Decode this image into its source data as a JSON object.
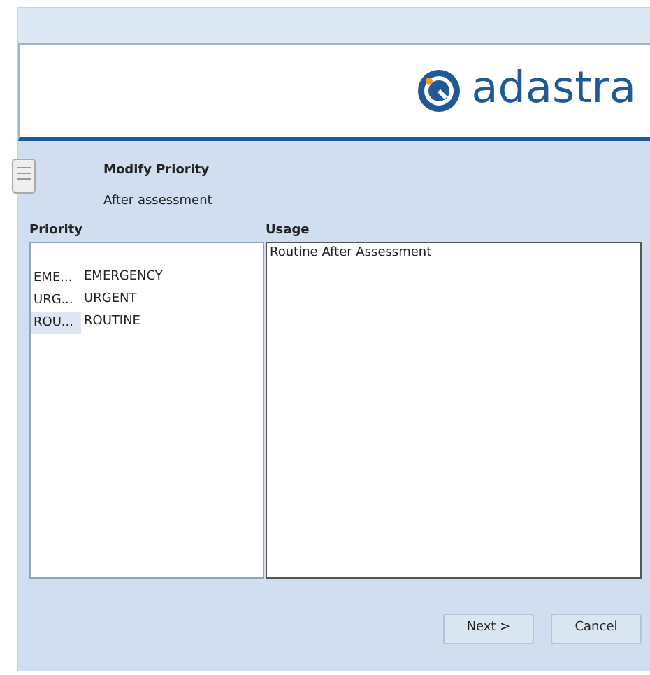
{
  "header": {
    "logo_text": "adastra"
  },
  "step": {
    "title": "Modify Priority",
    "subtitle": "After assessment"
  },
  "priority": {
    "heading": "Priority",
    "rows": [
      {
        "code": "EME...",
        "name": "EMERGENCY",
        "selected": false
      },
      {
        "code": "URG...",
        "name": "URGENT",
        "selected": false
      },
      {
        "code": "ROU...",
        "name": "ROUTINE",
        "selected": true
      }
    ]
  },
  "usage": {
    "heading": "Usage",
    "text": "Routine After Assessment"
  },
  "buttons": [
    {
      "label": "Next >"
    },
    {
      "label": "Cancel"
    }
  ]
}
